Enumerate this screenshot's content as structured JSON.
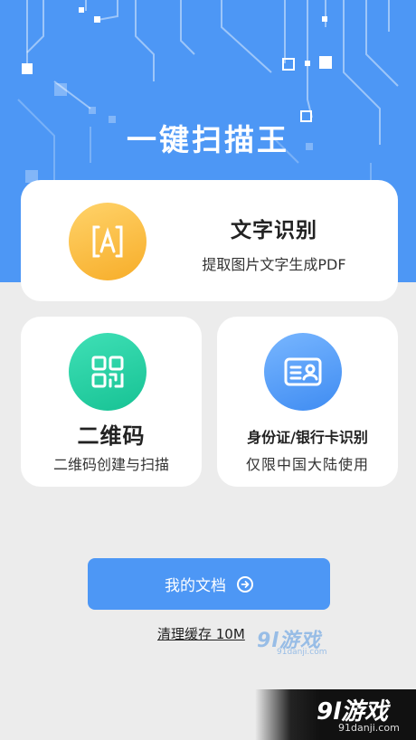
{
  "app": {
    "title": "一键扫描王"
  },
  "features": {
    "ocr": {
      "title": "文字识别",
      "subtitle": "提取图片文字生成PDF",
      "icon": "ocr-scan-icon"
    },
    "qrcode": {
      "title": "二维码",
      "subtitle": "二维码创建与扫描",
      "icon": "qrcode-icon"
    },
    "idcard": {
      "title": "身份证/银行卡识别",
      "subtitle": "仅限中国大陆使用",
      "icon": "id-card-icon"
    }
  },
  "actions": {
    "my_docs": "我的文档",
    "clear_cache": "清理缓存  10M"
  },
  "watermark": {
    "brand": "9l游戏",
    "url": "91danji.com"
  },
  "colors": {
    "primary": "#4d97f5",
    "ocr_icon": "#f7ad29",
    "qr_icon": "#17c294",
    "id_icon": "#3f8cf2",
    "background": "#ececec"
  }
}
